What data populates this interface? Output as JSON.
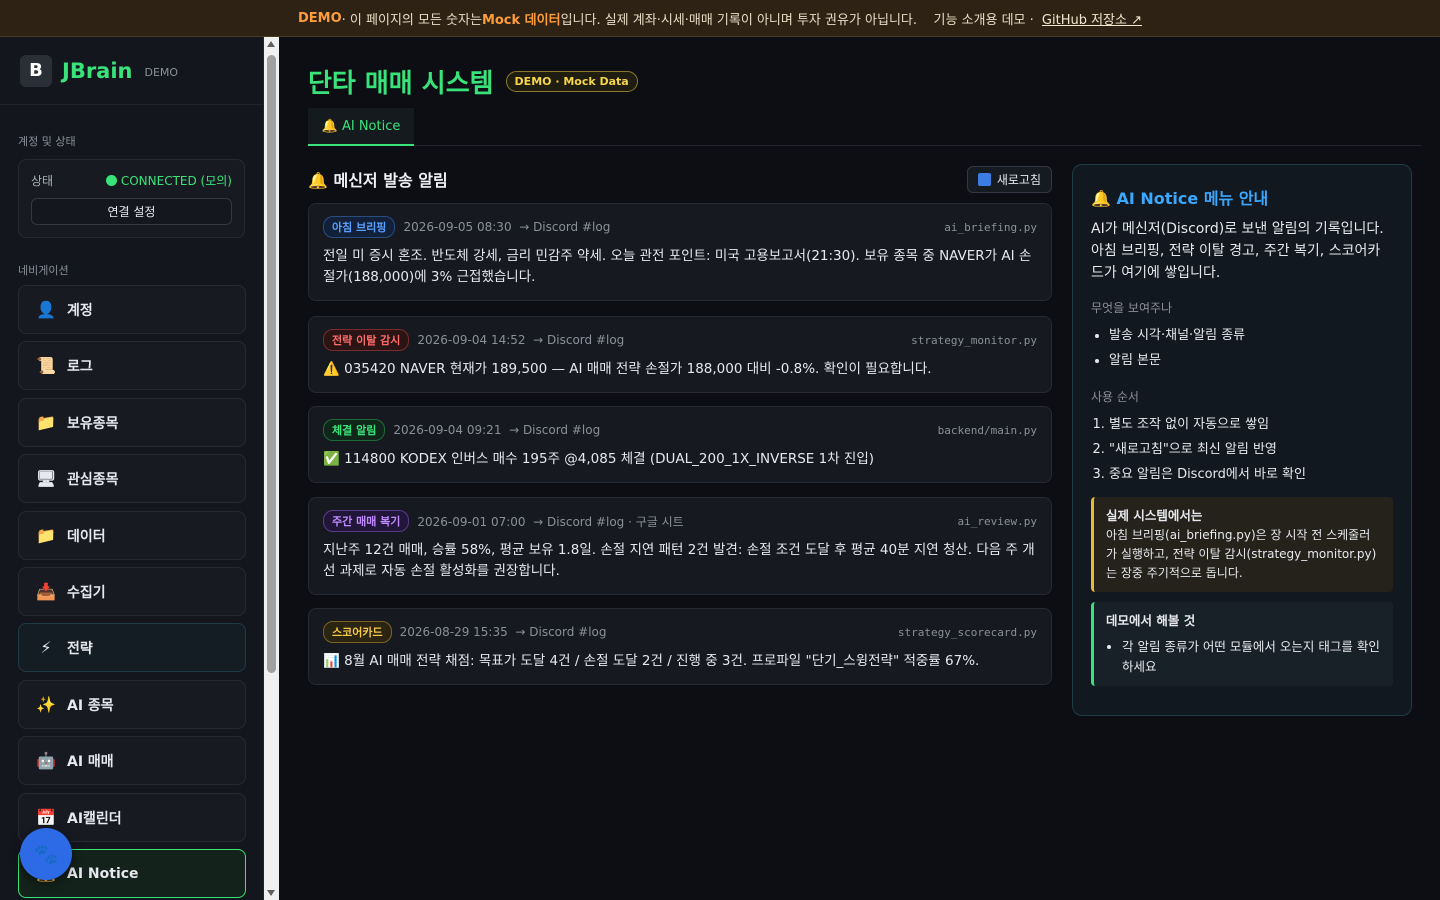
{
  "banner": {
    "demo": "DEMO",
    "text_before": " · 이 페이지의 모든 숫자는 ",
    "mock": "Mock 데이터",
    "text_after": "입니다. 실제 계좌·시세·매매 기록이 아니며 투자 권유가 아닙니다.    기능 소개용 데모 · ",
    "github": "GitHub 저장소 ↗"
  },
  "sidebar": {
    "logo_letter": "B",
    "app_name": "JBrain",
    "demo_label": "DEMO",
    "account_section": "계정 및 상태",
    "status_label": "상태",
    "status_value": "CONNECTED (모의)",
    "connect_button": "연결 설정",
    "nav_section": "네비게이션",
    "items": [
      {
        "icon": "person-icon",
        "glyph": "👤",
        "label": "계정"
      },
      {
        "icon": "scroll-icon",
        "glyph": "📜",
        "label": "로그"
      },
      {
        "icon": "folder-icon",
        "glyph": "📁",
        "label": "보유종목"
      },
      {
        "icon": "monitor-icon",
        "glyph": "🖥",
        "label": "관심종목"
      },
      {
        "icon": "folder-icon",
        "glyph": "📁",
        "label": "데이터"
      },
      {
        "icon": "inbox-icon",
        "glyph": "📥",
        "label": "수집기"
      },
      {
        "icon": "lightning-icon",
        "glyph": "⚡",
        "label": "전략"
      },
      {
        "icon": "sparkles-icon",
        "glyph": "✨",
        "label": "AI 종목"
      },
      {
        "icon": "robot-icon",
        "glyph": "🤖",
        "label": "AI 매매"
      },
      {
        "icon": "calendar-icon",
        "glyph": "📅",
        "label": "AI캘린더"
      },
      {
        "icon": "bell-icon",
        "glyph": "🔔",
        "label": "AI Notice"
      }
    ],
    "fab_glyph": "🐾"
  },
  "main": {
    "page_title": "단타 매매 시스템",
    "demo_pill": "DEMO · Mock Data",
    "tab_label": "🔔 AI Notice",
    "panel_title": "🔔 메신저 발송 알림",
    "refresh_label": "새로고침",
    "notices": [
      {
        "tag": "아침 브리핑",
        "tag_color": "blue",
        "meta": "2026-09-05 08:30  → Discord #log",
        "source": "ai_briefing.py",
        "body": "전일 미 증시 혼조. 반도체 강세, 금리 민감주 약세. 오늘 관전 포인트: 미국 고용보고서(21:30). 보유 종목 중 NAVER가 AI 손절가(188,000)에 3% 근접했습니다."
      },
      {
        "tag": "전략 이탈 감시",
        "tag_color": "red",
        "meta": "2026-09-04 14:52  → Discord #log",
        "source": "strategy_monitor.py",
        "body": "⚠️ 035420 NAVER 현재가 189,500 — AI 매매 전략 손절가 188,000 대비 -0.8%. 확인이 필요합니다."
      },
      {
        "tag": "체결 알림",
        "tag_color": "green",
        "meta": "2026-09-04 09:21  → Discord #log",
        "source": "backend/main.py",
        "body": "✅ 114800 KODEX 인버스 매수 195주 @4,085 체결 (DUAL_200_1X_INVERSE 1차 진입)"
      },
      {
        "tag": "주간 매매 복기",
        "tag_color": "purple",
        "meta": "2026-09-01 07:00  → Discord #log · 구글 시트",
        "source": "ai_review.py",
        "body": "지난주 12건 매매, 승률 58%, 평균 보유 1.8일. 손절 지연 패턴 2건 발견: 손절 조건 도달 후 평균 40분 지연 청산. 다음 주 개선 과제로 자동 손절 활성화를 권장합니다."
      },
      {
        "tag": "스코어카드",
        "tag_color": "yellow",
        "meta": "2026-08-29 15:35  → Discord #log",
        "source": "strategy_scorecard.py",
        "body": "📊 8월 AI 매매 전략 채점: 목표가 도달 4건 / 손절 도달 2건 / 진행 중 3건. 프로파일 \"단기_스윙전략\" 적중률 67%."
      }
    ]
  },
  "guide": {
    "title": "🔔 AI Notice 메뉴 안내",
    "desc": "AI가 메신저(Discord)로 보낸 알림의 기록입니다. 아침 브리핑, 전략 이탈 경고, 주간 복기, 스코어카드가 여기에 쌓입니다.",
    "what_label": "무엇을 보여주나",
    "what_items": [
      "발송 시각·채널·알림 종류",
      "알림 본문"
    ],
    "order_label": "사용 순서",
    "order_items": [
      "별도 조작 없이 자동으로 쌓임",
      "\"새로고침\"으로 최신 알림 반영",
      "중요 알림은 Discord에서 바로 확인"
    ],
    "real_title": "실제 시스템에서는",
    "real_body": "아침 브리핑(ai_briefing.py)은 장 시작 전 스케줄러가 실행하고, 전략 이탈 감시(strategy_monitor.py)는 장중 주기적으로 돕니다.",
    "try_title": "데모에서 해볼 것",
    "try_items": [
      "각 알림 종류가 어떤 모듈에서 오는지 태그를 확인하세요"
    ]
  }
}
